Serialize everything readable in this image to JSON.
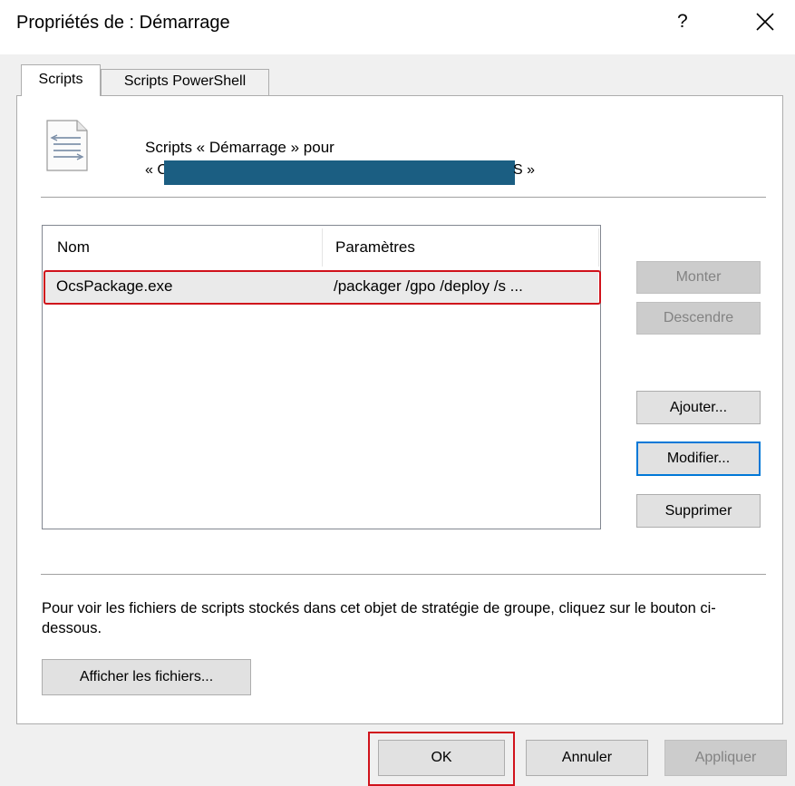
{
  "window": {
    "title": "Propriétés de : Démarrage",
    "help": "?"
  },
  "tabs": [
    {
      "label": "Scripts",
      "active": true
    },
    {
      "label": "Scripts PowerShell",
      "active": false
    }
  ],
  "header": {
    "line1": "Scripts « Démarrage » pour",
    "line2_start": "« C",
    "line2_end": "S »"
  },
  "table": {
    "columns": [
      "Nom",
      "Paramètres"
    ],
    "rows": [
      {
        "name": "OcsPackage.exe",
        "params": "/packager /gpo /deploy /s  ..."
      }
    ]
  },
  "side_buttons": {
    "up": "Monter",
    "down": "Descendre",
    "add": "Ajouter...",
    "edit": "Modifier...",
    "remove": "Supprimer"
  },
  "info_text": "Pour voir les fichiers de scripts stockés dans cet objet de stratégie de groupe, cliquez sur le bouton ci-dessous.",
  "show_files_button": "Afficher les fichiers...",
  "footer": {
    "ok": "OK",
    "cancel": "Annuler",
    "apply": "Appliquer"
  },
  "colors": {
    "highlight_outline": "#d0121b",
    "redaction": "#1b5e82",
    "focus": "#0078d7"
  }
}
